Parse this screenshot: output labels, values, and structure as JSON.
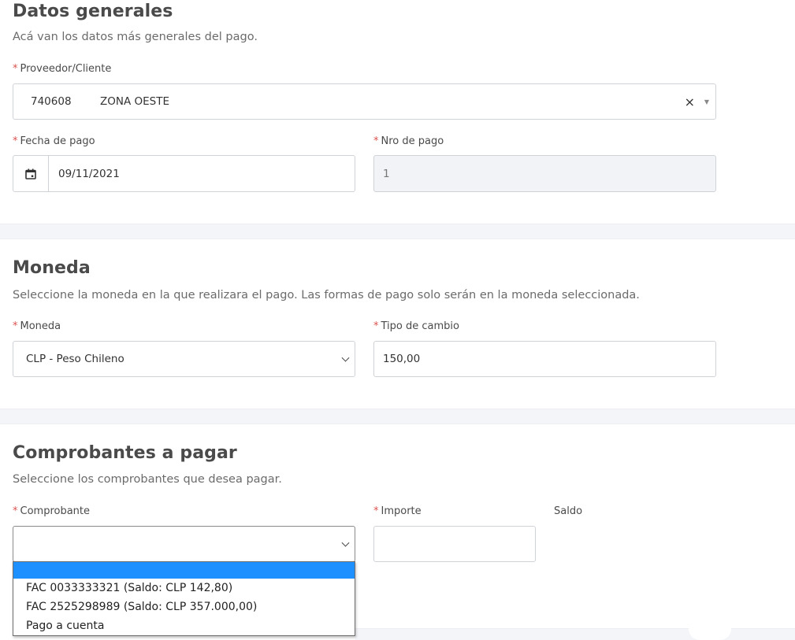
{
  "datos_generales": {
    "title": "Datos generales",
    "description": "Acá van los datos más generales del pago.",
    "proveedor": {
      "label": "Proveedor/Cliente",
      "code": "740608",
      "name": "ZONA OESTE",
      "clear_glyph": "×",
      "caret_glyph": "▼"
    },
    "fecha": {
      "label": "Fecha de pago",
      "value": "09/11/2021"
    },
    "nro_pago": {
      "label": "Nro de pago",
      "value": "1"
    }
  },
  "moneda": {
    "title": "Moneda",
    "description": "Seleccione la moneda en la que realizara el pago. Las formas de pago solo serán en la moneda seleccionada.",
    "moneda_field": {
      "label": "Moneda",
      "value": "CLP - Peso Chileno"
    },
    "tipo_cambio": {
      "label": "Tipo de cambio",
      "value": "150,00"
    }
  },
  "comprobantes": {
    "title": "Comprobantes a pagar",
    "description": "Seleccione los comprobantes que desea pagar.",
    "comprobante": {
      "label": "Comprobante",
      "value": "",
      "options": [
        "",
        "FAC 0033333321 (Saldo: CLP 142,80)",
        "FAC 2525298989 (Saldo: CLP 357.000,00)",
        "Pago a cuenta"
      ]
    },
    "importe": {
      "label": "Importe",
      "value": ""
    },
    "saldo": {
      "label": "Saldo"
    }
  },
  "required_marker": "*",
  "colors": {
    "required": "#d9534f",
    "highlight": "#1e90ff",
    "band": "#f4f5f8"
  }
}
